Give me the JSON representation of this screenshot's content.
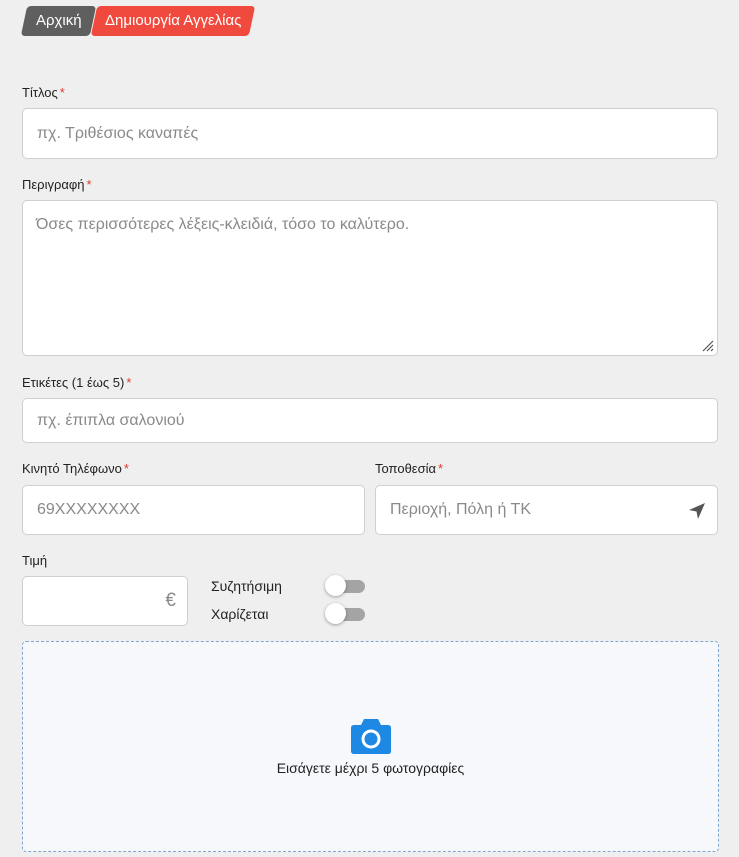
{
  "breadcrumb": {
    "home": "Αρχική",
    "current": "Δημιουργία Αγγελίας"
  },
  "form": {
    "title": {
      "label": "Τίτλος",
      "required": "*",
      "placeholder": "πχ. Τριθέσιος καναπές",
      "value": ""
    },
    "description": {
      "label": "Περιγραφή",
      "required": "*",
      "placeholder": "Όσες περισσότερες λέξεις-κλειδιά, τόσο το καλύτερο.",
      "value": ""
    },
    "tags": {
      "label": "Ετικέτες (1 έως 5)",
      "required": "*",
      "placeholder": "πχ. έπιπλα σαλονιού",
      "value": ""
    },
    "phone": {
      "label": "Κινητό Τηλέφωνο",
      "required": "*",
      "placeholder": "69XXXXXXXX",
      "value": ""
    },
    "location": {
      "label": "Τοποθεσία",
      "required": "*",
      "placeholder": "Περιοχή, Πόλη ή ΤΚ",
      "value": "",
      "icon": "location-arrow-icon"
    },
    "price": {
      "label": "Τιμή",
      "currency": "€",
      "value": ""
    },
    "negotiable": {
      "label": "Συζητήσιμη",
      "on": false
    },
    "free": {
      "label": "Χαρίζεται",
      "on": false
    }
  },
  "upload": {
    "icon": "camera-icon",
    "text": "Εισάγετε μέχρι 5 φωτογραφίες"
  },
  "colors": {
    "background": "#efefef",
    "crumb_home": "#5f5f5f",
    "crumb_current": "#f04a3e",
    "required": "#e03a2f",
    "camera": "#1e88e5",
    "dropzone_border": "#7ea6cf"
  }
}
